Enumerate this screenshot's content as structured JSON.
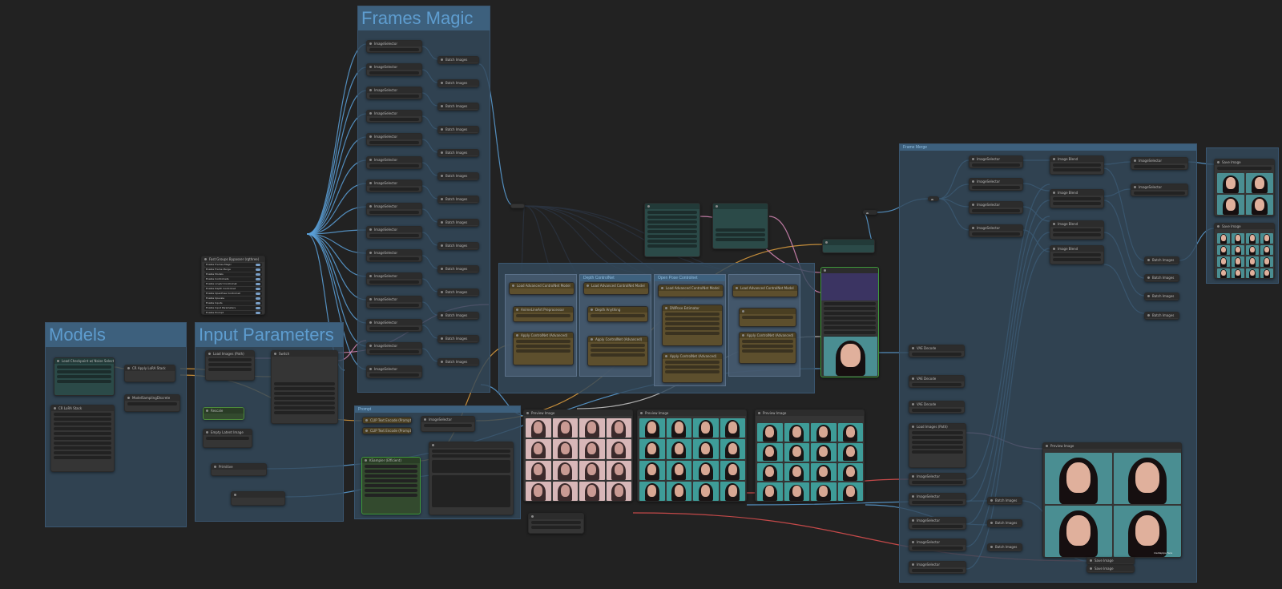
{
  "groups": {
    "frames_magic": "Frames Magic",
    "models": "Models",
    "input_parameters": "Input Parameters",
    "frame_merge": "Frame Merge",
    "prompt": "Prompt",
    "depth_controlnet": "Depth ControlNet",
    "openpose_controlnet": "Open Pose Controlnet"
  },
  "nodes": {
    "load_checkpoint": "Load Checkpoint w/ Noise Select",
    "lora_stack": "CR LoRA Stack",
    "apply_lora_stack": "CR Apply LoRA Stack",
    "model_sampling": "ModelSamplingDiscrete",
    "load_images": "Load Images (Path)",
    "rescale": "Rescale",
    "empty_latent": "Empty Latent Image",
    "int_primitive": "Primitive",
    "switch": "Switch",
    "text_fast_bypass": "Fast Groups Bypasser (rgthree)",
    "text_encode_pos": "CLIP Text Encode (Prompt)",
    "text_encode_neg": "CLIP Text Encode (Prompt)",
    "image_selector": "ImageSelector",
    "batch_images": "Batch Images",
    "preview_image": "Preview Image",
    "ksampler": "KSampler (Efficient)",
    "controlnet_loader": "Load Advanced ControlNet Model",
    "apply_controlnet": "Apply ControlNet (Advanced)",
    "image_blend": "Image Blend",
    "vae_decode": "VAE Decode",
    "save_image": "Save Image",
    "load_images_path": "Load Images (Path)",
    "anime_lineart": "AnimeLineArt Preprocessor",
    "depth_anything": "Depth Anything",
    "dwpose": "DWPose Estimator"
  },
  "bypasser_items": [
    "Enable Frames Magic",
    "Enable Frame Merge",
    "Enable Models",
    "Enable Controlnets",
    "Enable LineArt Controlnet",
    "Enable Depth Controlnet",
    "Enable OpenPose Controlnet",
    "Enable Upscale",
    "Enable Inputs",
    "Enable Input Parameters",
    "Enable Prompt"
  ],
  "watermark": "mediapipe face",
  "colors": {
    "background": "#222222",
    "group_blue": "#33495c",
    "wire_blue": "#5aa0d8",
    "wire_orange": "#e0a040",
    "wire_pink": "#d88ab8",
    "wire_red": "#e05050"
  }
}
